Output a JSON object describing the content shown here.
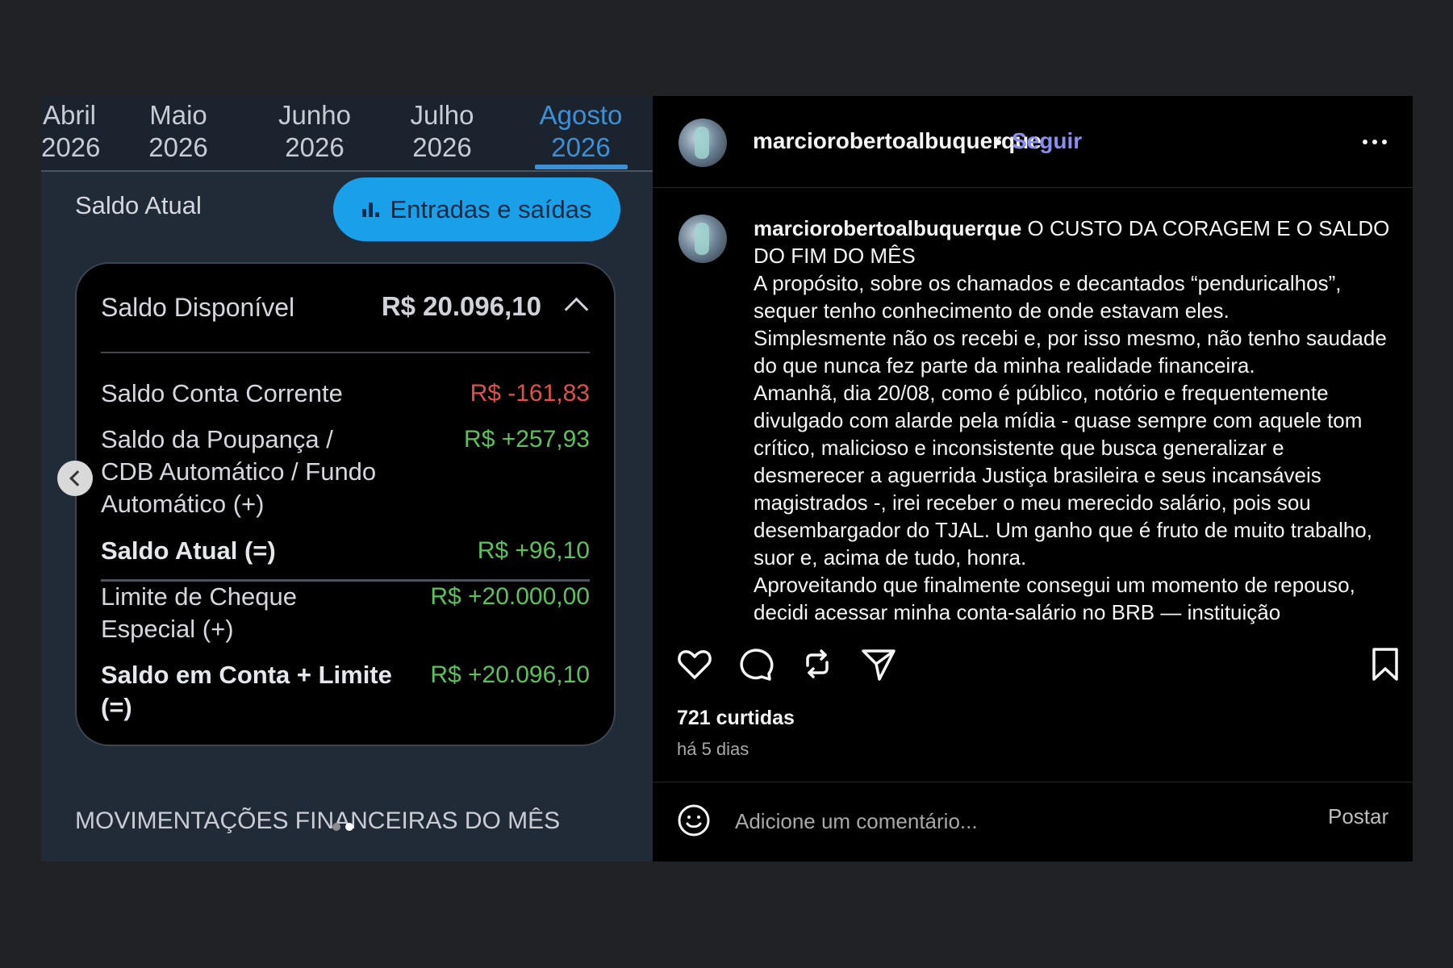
{
  "bank": {
    "months": [
      {
        "name": "Abril",
        "year": "2026"
      },
      {
        "name": "Maio",
        "year": "2026"
      },
      {
        "name": "Junho",
        "year": "2026"
      },
      {
        "name": "Julho",
        "year": "2026"
      },
      {
        "name": "Agosto",
        "year": "2026",
        "active": true
      }
    ],
    "saldo_atual_title": "Saldo Atual",
    "entradas_button": "Entradas e saídas",
    "card": {
      "saldo_disponivel_label": "Saldo Disponível",
      "saldo_disponivel_value": "R$ 20.096,10",
      "rows": {
        "conta_corrente": {
          "label": "Saldo Conta Corrente",
          "value": "R$ -161,83"
        },
        "poupanca": {
          "label_line1": "Saldo da Poupança /",
          "label_line2": "CDB Automático / Fundo",
          "label_line3": "Automático (+)",
          "value": "R$ +257,93"
        },
        "saldo_atual": {
          "label": "Saldo Atual (=)",
          "value": "R$ +96,10"
        },
        "limite": {
          "label_line1": "Limite de Cheque",
          "label_line2": "Especial (+)",
          "value": "R$ +20.000,00"
        },
        "conta_limite": {
          "label_line1": "Saldo em Conta + Limite",
          "label_line2": "(=)",
          "value": "R$ +20.096,10"
        }
      }
    },
    "movimentacoes_title": "MOVIMENTAÇÕES FINANCEIRAS DO MÊS",
    "carousel": {
      "slide_count": 2,
      "current_slide": 2
    }
  },
  "post": {
    "username": "marciorobertoalbuquerque",
    "follow_label": "Seguir",
    "caption_title": "O CUSTO DA CORAGEM E O SALDO DO FIM DO MÊS",
    "caption_paragraphs": [
      "A propósito, sobre os chamados e decantados “penduricalhos”, sequer tenho conhecimento de onde estavam eles.",
      "Simplesmente não os recebi e, por isso mesmo, não tenho saudade do que nunca fez parte da minha realidade financeira.",
      "Amanhã, dia 20/08, como é público, notório e frequentemente divulgado com alarde pela mídia - quase sempre com aquele tom crítico, malicioso e inconsistente que busca generalizar e desmerecer a aguerrida Justiça brasileira e seus incansáveis magistrados -, irei receber o meu merecido salário, pois sou desembargador do TJAL. Um ganho que é fruto de muito trabalho, suor e, acima de tudo, honra.",
      "Aproveitando que finalmente consegui um momento de repouso, decidi acessar minha conta-salário no BRB — instituição"
    ],
    "likes": "721 curtidas",
    "time_ago": "há 5 dias",
    "comment_placeholder": "Adicione um comentário...",
    "post_button": "Postar"
  }
}
